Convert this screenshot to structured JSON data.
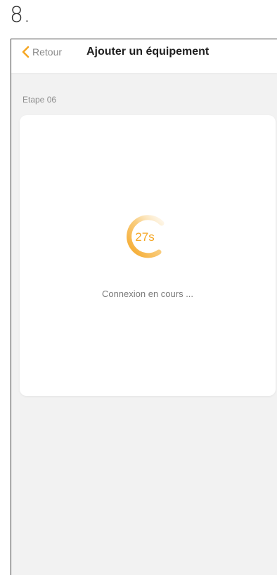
{
  "step_number": "8.",
  "navbar": {
    "back_label": "Retour",
    "title": "Ajouter un équipement"
  },
  "step_label": "Etape 06",
  "progress": {
    "countdown": "27s",
    "status_text": "Connexion en cours ..."
  },
  "colors": {
    "accent": "#f5a623",
    "background": "#f2f2f2",
    "card": "#ffffff"
  },
  "icons": {
    "back": "chevron-left-icon",
    "spinner": "loading-spinner-icon"
  }
}
